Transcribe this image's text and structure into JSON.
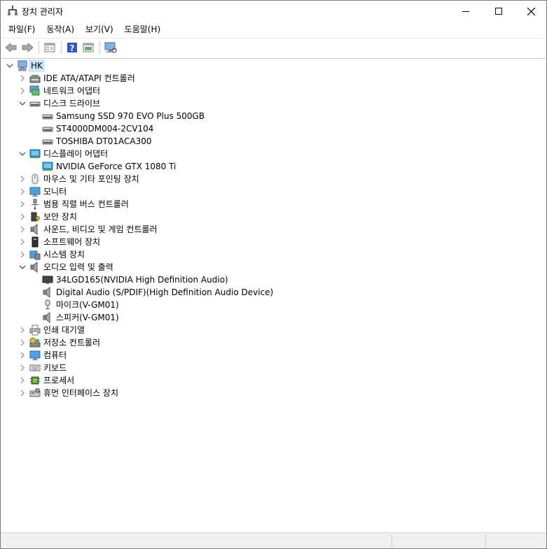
{
  "window": {
    "title": "장치 관리자"
  },
  "menu": [
    "파일(F)",
    "동작(A)",
    "보기(V)",
    "도움말(H)"
  ],
  "toolbar_icons": [
    "back-arrow-icon",
    "forward-arrow-icon",
    "properties-icon",
    "help-icon",
    "show-hidden-icon",
    "scan-hardware-icon"
  ],
  "tree": [
    {
      "label": "HK",
      "level": 0,
      "state": "expanded",
      "icon": "computer-icon",
      "selected": true
    },
    {
      "label": "IDE ATA/ATAPI 컨트롤러",
      "level": 1,
      "state": "collapsed",
      "icon": "ide-controller-icon"
    },
    {
      "label": "네트워크 어댑터",
      "level": 1,
      "state": "collapsed",
      "icon": "network-adapter-icon"
    },
    {
      "label": "디스크 드라이브",
      "level": 1,
      "state": "expanded",
      "icon": "disk-drive-icon"
    },
    {
      "label": "Samsung SSD 970 EVO Plus 500GB",
      "level": 2,
      "state": "leaf",
      "icon": "disk-drive-icon"
    },
    {
      "label": "ST4000DM004-2CV104",
      "level": 2,
      "state": "leaf",
      "icon": "disk-drive-icon"
    },
    {
      "label": "TOSHIBA DT01ACA300",
      "level": 2,
      "state": "leaf",
      "icon": "disk-drive-icon"
    },
    {
      "label": "디스플레이 어댑터",
      "level": 1,
      "state": "expanded",
      "icon": "display-adapter-icon"
    },
    {
      "label": "NVIDIA GeForce GTX 1080 Ti",
      "level": 2,
      "state": "leaf",
      "icon": "display-adapter-icon"
    },
    {
      "label": "마우스 및 기타 포인팅 장치",
      "level": 1,
      "state": "collapsed",
      "icon": "mouse-icon"
    },
    {
      "label": "모니터",
      "level": 1,
      "state": "collapsed",
      "icon": "monitor-icon"
    },
    {
      "label": "범용 직렬 버스 컨트롤러",
      "level": 1,
      "state": "collapsed",
      "icon": "usb-icon"
    },
    {
      "label": "보안 장치",
      "level": 1,
      "state": "collapsed",
      "icon": "security-device-icon"
    },
    {
      "label": "사운드, 비디오 및 게임 컨트롤러",
      "level": 1,
      "state": "collapsed",
      "icon": "speaker-icon"
    },
    {
      "label": "소프트웨어 장치",
      "level": 1,
      "state": "collapsed",
      "icon": "software-device-icon"
    },
    {
      "label": "시스템 장치",
      "level": 1,
      "state": "collapsed",
      "icon": "system-device-icon"
    },
    {
      "label": "오디오 입력 및 출력",
      "level": 1,
      "state": "expanded",
      "icon": "speaker-icon"
    },
    {
      "label": "34LGD165(NVIDIA High Definition Audio)",
      "level": 2,
      "state": "leaf",
      "icon": "display-audio-icon"
    },
    {
      "label": "Digital Audio (S/PDIF)(High Definition Audio Device)",
      "level": 2,
      "state": "leaf",
      "icon": "speaker-icon"
    },
    {
      "label": "마이크(V-GM01)",
      "level": 2,
      "state": "leaf",
      "icon": "microphone-icon"
    },
    {
      "label": "스피커(V-GM01)",
      "level": 2,
      "state": "leaf",
      "icon": "speaker-icon"
    },
    {
      "label": "인쇄 대기열",
      "level": 1,
      "state": "collapsed",
      "icon": "printer-icon"
    },
    {
      "label": "저장소 컨트롤러",
      "level": 1,
      "state": "collapsed",
      "icon": "storage-controller-icon"
    },
    {
      "label": "컴퓨터",
      "level": 1,
      "state": "collapsed",
      "icon": "monitor-icon"
    },
    {
      "label": "키보드",
      "level": 1,
      "state": "collapsed",
      "icon": "keyboard-icon"
    },
    {
      "label": "프로세서",
      "level": 1,
      "state": "collapsed",
      "icon": "processor-icon"
    },
    {
      "label": "휴먼 인터페이스 장치",
      "level": 1,
      "state": "collapsed",
      "icon": "hid-icon"
    }
  ]
}
